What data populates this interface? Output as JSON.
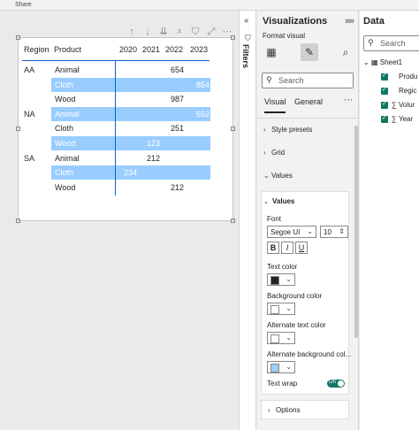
{
  "topbar": {
    "share": "Share"
  },
  "table": {
    "headers": [
      "Region",
      "Product",
      "2020",
      "2021",
      "2022",
      "2023"
    ],
    "rows": [
      {
        "region": "AA",
        "product": "Animal",
        "v2020": "",
        "v2021": "",
        "v2022": "654",
        "v2023": "",
        "highlight": false
      },
      {
        "region": "",
        "product": "Cloth",
        "v2020": "",
        "v2021": "",
        "v2022": "",
        "v2023": "854",
        "highlight": true
      },
      {
        "region": "",
        "product": "Wood",
        "v2020": "",
        "v2021": "",
        "v2022": "987",
        "v2023": "",
        "highlight": false
      },
      {
        "region": "NA",
        "product": "Animal",
        "v2020": "",
        "v2021": "",
        "v2022": "",
        "v2023": "652",
        "highlight": true
      },
      {
        "region": "",
        "product": "Cloth",
        "v2020": "",
        "v2021": "",
        "v2022": "251",
        "v2023": "",
        "highlight": false
      },
      {
        "region": "",
        "product": "Wood",
        "v2020": "",
        "v2021": "123",
        "v2022": "",
        "v2023": "",
        "highlight": true
      },
      {
        "region": "SA",
        "product": "Animal",
        "v2020": "",
        "v2021": "212",
        "v2022": "",
        "v2023": "",
        "highlight": false
      },
      {
        "region": "",
        "product": "Cloth",
        "v2020": "234",
        "v2021": "",
        "v2022": "",
        "v2023": "",
        "highlight": true
      },
      {
        "region": "",
        "product": "Wood",
        "v2020": "",
        "v2021": "",
        "v2022": "212",
        "v2023": "",
        "highlight": false
      }
    ]
  },
  "filters": {
    "label": "Filters"
  },
  "visualizations": {
    "title": "Visualizations",
    "format_visual": "Format visual",
    "search_placeholder": "Search",
    "tabs": [
      "Visual",
      "General"
    ],
    "sections": {
      "style_presets": "Style presets",
      "grid": "Grid",
      "values": "Values",
      "values_sub": "Values",
      "options": "Options"
    },
    "font_label": "Font",
    "font_family": "Segoe UI",
    "font_size": "10",
    "bold": "B",
    "italic": "I",
    "underline": "U",
    "text_color_label": "Text color",
    "background_color_label": "Background color",
    "alt_text_color_label": "Alternate text color",
    "alt_background_color_label": "Alternate background col...",
    "text_wrap_label": "Text wrap",
    "text_wrap_state": "On",
    "colors": {
      "text": "#252423",
      "background": "#ffffff",
      "alt_text": "#ffffff",
      "alt_background": "#99cdff"
    }
  },
  "data_pane": {
    "title": "Data",
    "search_placeholder": "Search",
    "table": "Sheet1",
    "fields": [
      {
        "label": "Produ",
        "sigma": false
      },
      {
        "label": "Regic",
        "sigma": false
      },
      {
        "label": "Volur",
        "sigma": true
      },
      {
        "label": "Year",
        "sigma": true
      }
    ]
  }
}
